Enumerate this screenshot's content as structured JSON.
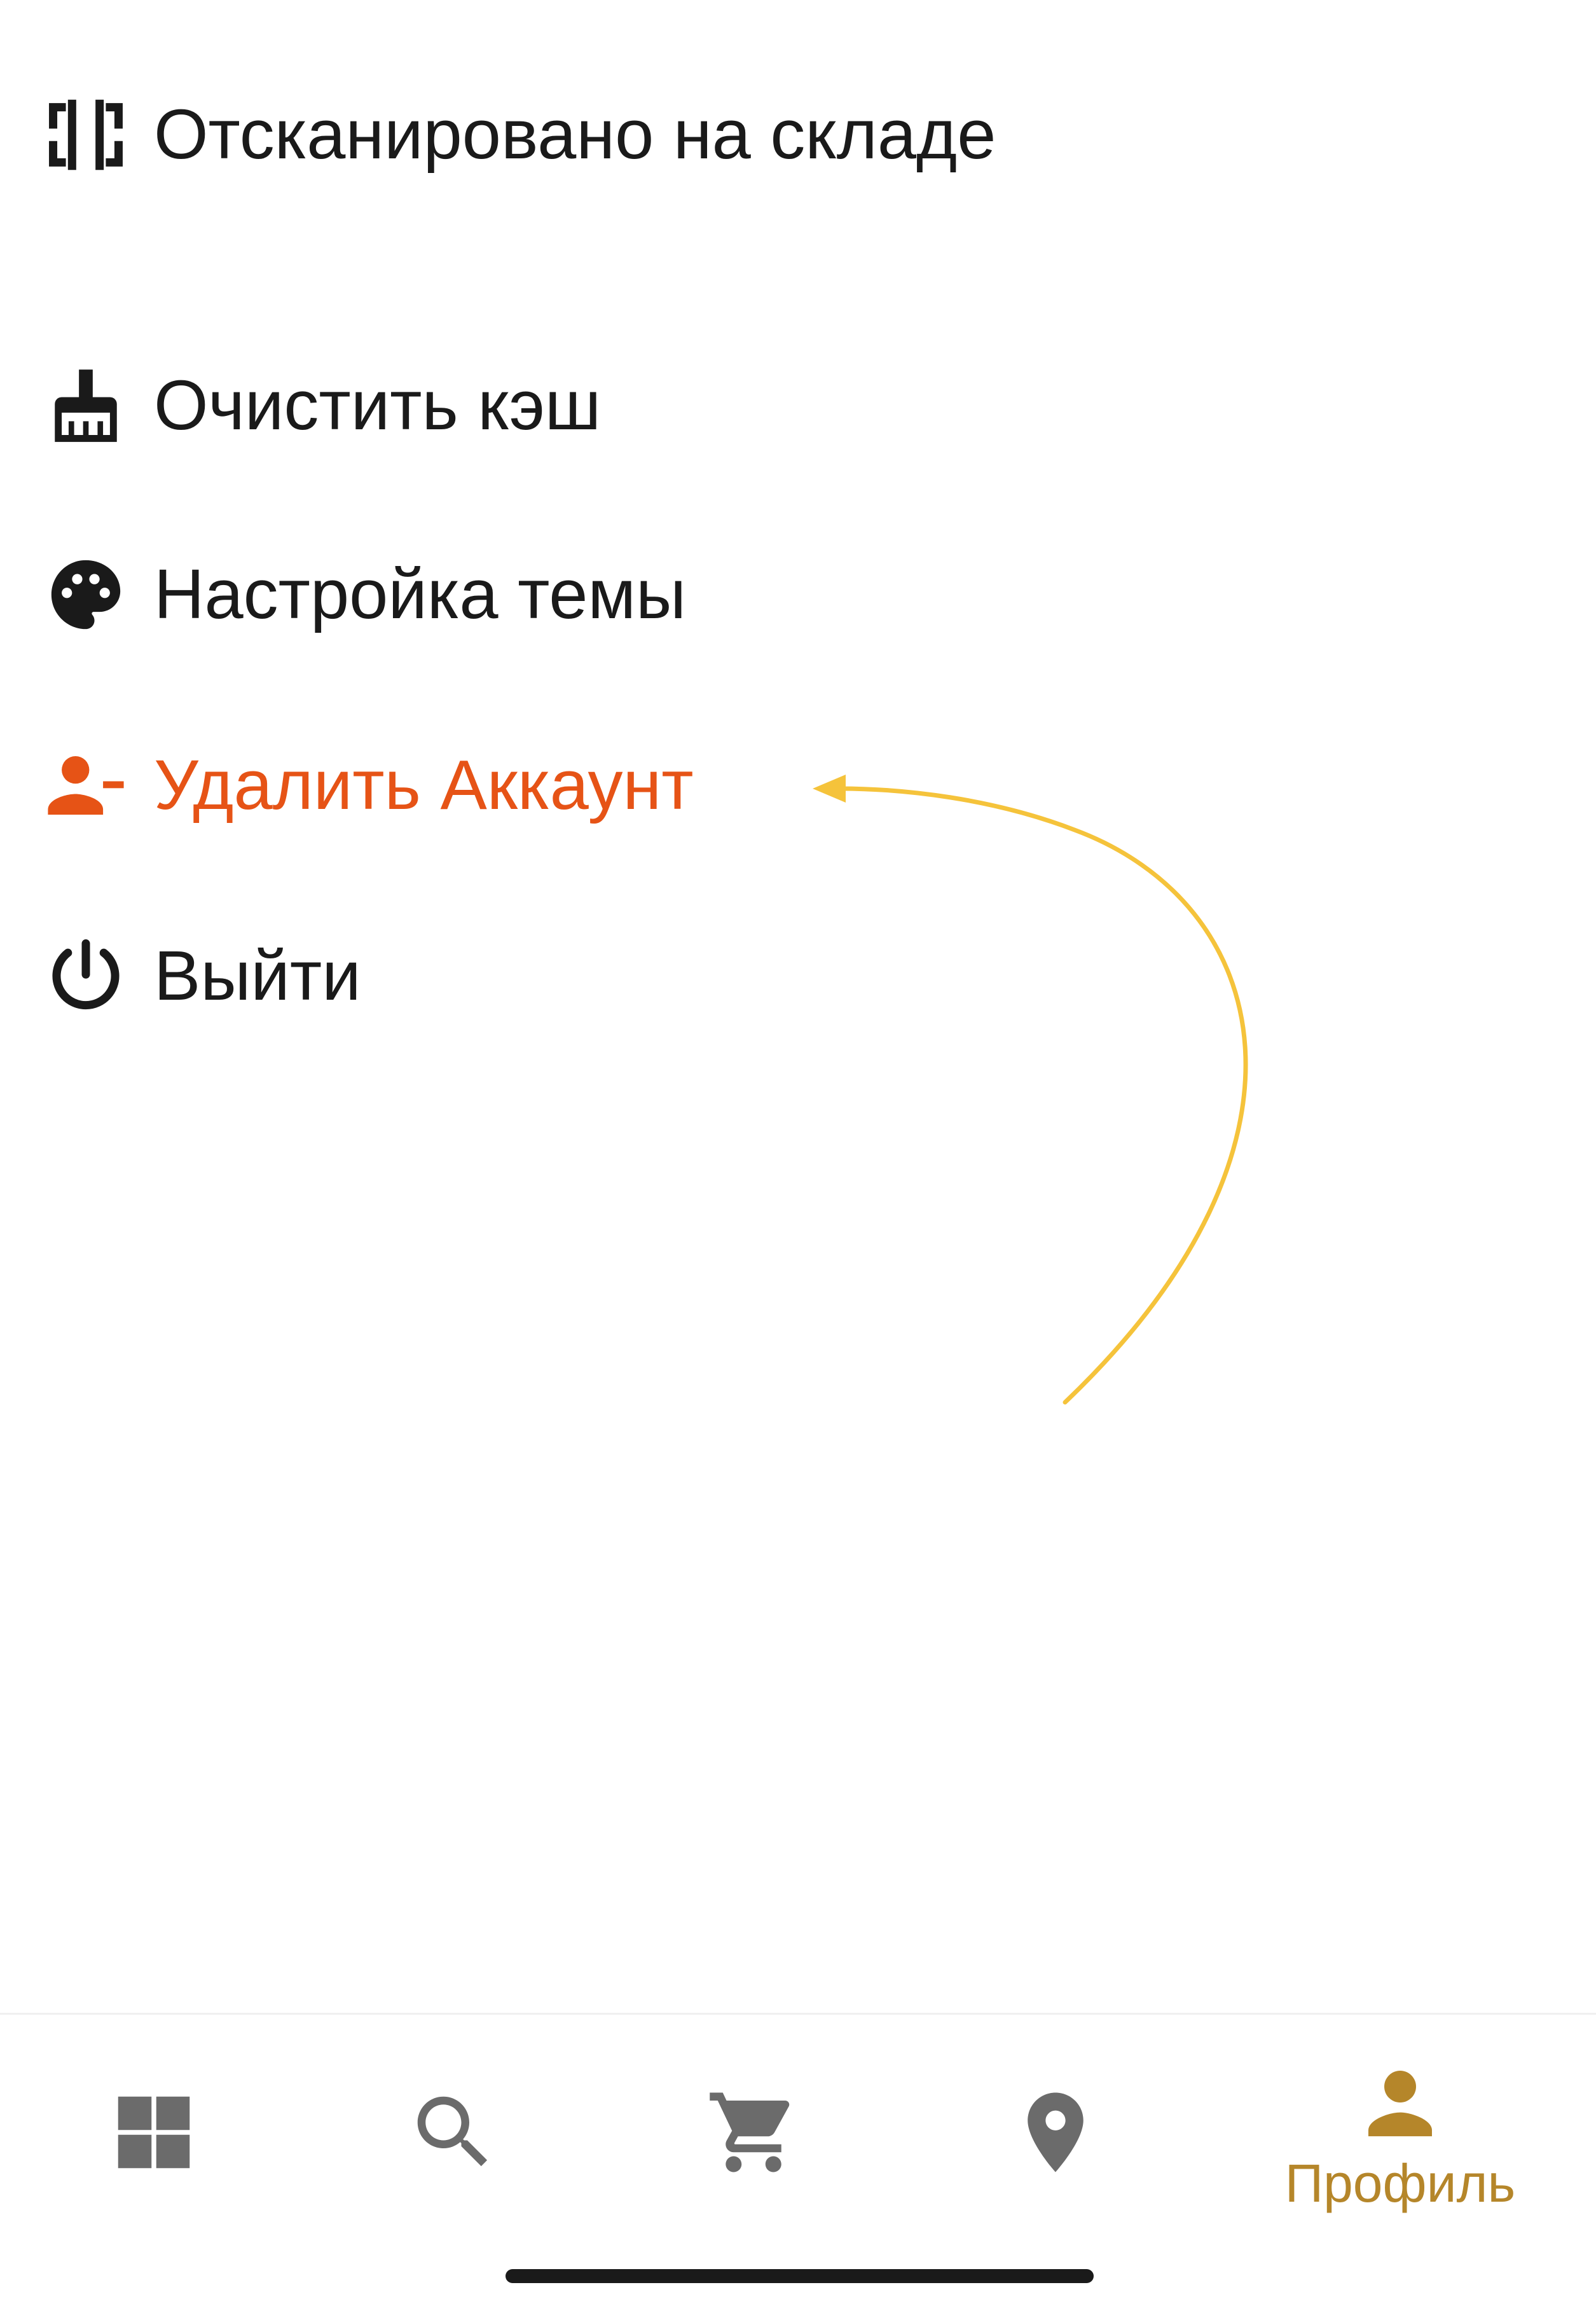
{
  "menu": {
    "items": [
      {
        "label": "Отсканировано на складе",
        "icon": "barcode-scan-icon"
      },
      {
        "label": "Очистить кэш",
        "icon": "broom-icon"
      },
      {
        "label": "Настройка темы",
        "icon": "palette-icon"
      },
      {
        "label": "Удалить Аккаунт",
        "icon": "person-remove-icon"
      },
      {
        "label": "Выйти",
        "icon": "power-icon"
      }
    ]
  },
  "bottom_nav": {
    "items": [
      {
        "icon": "grid-icon"
      },
      {
        "icon": "search-icon"
      },
      {
        "icon": "cart-icon"
      },
      {
        "icon": "location-pin-icon"
      },
      {
        "icon": "person-icon",
        "label": "Профиль",
        "active": true
      }
    ]
  },
  "colors": {
    "text": "#1a1a1a",
    "danger": "#e65316",
    "nav_inactive": "#6b6b6b",
    "nav_active": "#b5862a",
    "annotation": "#f5c33b"
  }
}
